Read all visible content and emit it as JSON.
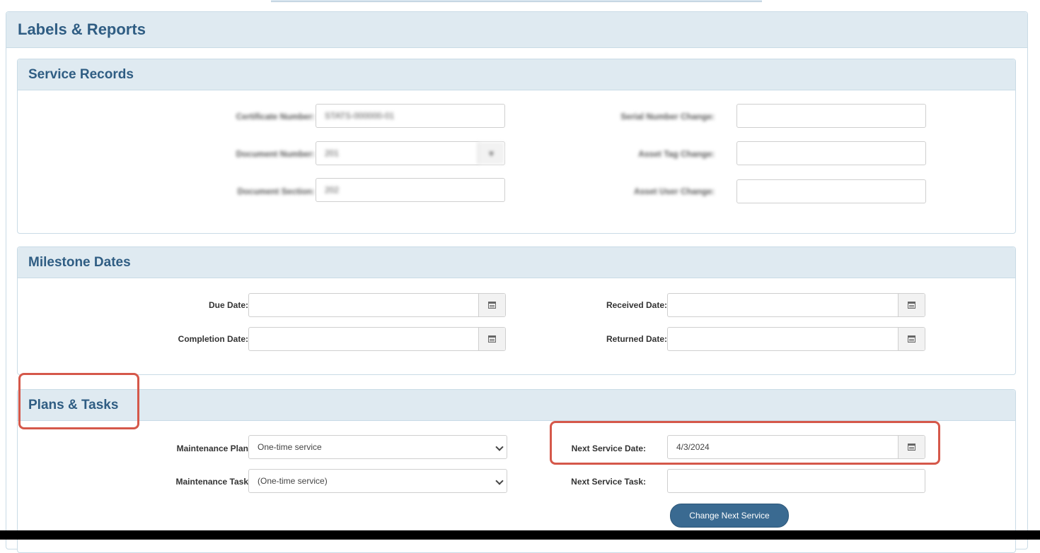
{
  "page": {
    "title": "Labels & Reports"
  },
  "service_records": {
    "title": "Service Records",
    "certificate_number": {
      "label": "Certificate Number:",
      "value": "STATS-000000-01"
    },
    "document_number": {
      "label": "Document Number:",
      "value": "201"
    },
    "document_section": {
      "label": "Document Section:",
      "value": "202"
    },
    "serial_number_change": {
      "label": "Serial Number Change:",
      "value": ""
    },
    "asset_tag_change": {
      "label": "Asset Tag Change:",
      "value": ""
    },
    "asset_user_change": {
      "label": "Asset User Change:",
      "value": ""
    }
  },
  "milestone_dates": {
    "title": "Milestone Dates",
    "due_date": {
      "label": "Due Date:",
      "value": ""
    },
    "completion_date": {
      "label": "Completion Date:",
      "value": ""
    },
    "received_date": {
      "label": "Received Date:",
      "value": ""
    },
    "returned_date": {
      "label": "Returned Date:",
      "value": ""
    }
  },
  "plans_tasks": {
    "title": "Plans & Tasks",
    "maintenance_plan": {
      "label": "Maintenance Plan:",
      "value": "One-time service"
    },
    "maintenance_task": {
      "label": "Maintenance Task:",
      "value": "(One-time service)"
    },
    "next_service_date": {
      "label": "Next Service Date:",
      "value": "4/3/2024"
    },
    "next_service_task": {
      "label": "Next Service Task:",
      "value": ""
    },
    "change_button": "Change Next Service"
  },
  "icons": {
    "calendar": "calendar-icon",
    "dropdown": "chevron-down-icon"
  },
  "colors": {
    "header_text": "#2f5d83",
    "panel_header_bg": "#dfeaf1",
    "button_bg": "#3a6a91",
    "highlight": "#d5584a"
  }
}
